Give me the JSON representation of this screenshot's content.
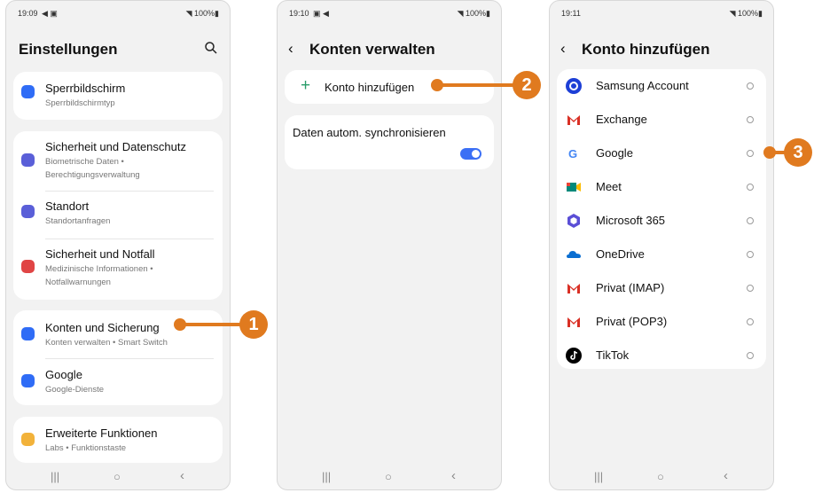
{
  "screen1": {
    "time": "19:09",
    "status_icons": "◀ ▣",
    "battery": "◥ 100%▮",
    "title": "Einstellungen",
    "items": [
      {
        "title": "Sperrbildschirm",
        "sub": "Sperrbildschirmtyp",
        "icon_color": "#2f6cf6"
      },
      {
        "title": "Sicherheit und Datenschutz",
        "sub": "Biometrische Daten •",
        "sub2": "Berechtigungsverwaltung",
        "icon_color": "#5a5fd8"
      },
      {
        "title": "Standort",
        "sub": "Standortanfragen",
        "icon_color": "#5a5fd8"
      },
      {
        "title": "Sicherheit und Notfall",
        "sub": "Medizinische Informationen •",
        "sub2": "Notfallwarnungen",
        "icon_color": "#e04545"
      },
      {
        "title": "Konten und Sicherung",
        "sub": "Konten verwalten • Smart Switch",
        "icon_color": "#2f6cf6"
      },
      {
        "title": "Google",
        "sub": "Google-Dienste",
        "icon_color": "#2f6cf6"
      },
      {
        "title": "Erweiterte Funktionen",
        "sub": "Labs • Funktionstaste",
        "icon_color": "#f2b23a"
      }
    ]
  },
  "screen2": {
    "time": "19:10",
    "status_icons": "▣ ◀",
    "battery": "◥ 100%▮",
    "title": "Konten verwalten",
    "add_label": "Konto hinzufügen",
    "sync_label": "Daten autom. synchronisieren"
  },
  "screen3": {
    "time": "19:11",
    "battery": "◥ 100%▮",
    "title": "Konto hinzufügen",
    "accounts": [
      {
        "label": "Samsung Account",
        "icon": "samsung-account-icon",
        "color": "#1d3fd6"
      },
      {
        "label": "Exchange",
        "icon": "gmail-icon",
        "color": "#d93025"
      },
      {
        "label": "Google",
        "icon": "google-icon",
        "color": "#4285f4"
      },
      {
        "label": "Meet",
        "icon": "meet-icon",
        "color": "#00897b"
      },
      {
        "label": "Microsoft 365",
        "icon": "microsoft-365-icon",
        "color": "#5b4fd6"
      },
      {
        "label": "OneDrive",
        "icon": "onedrive-icon",
        "color": "#0a6ed1"
      },
      {
        "label": "Privat (IMAP)",
        "icon": "gmail-icon",
        "color": "#d93025"
      },
      {
        "label": "Privat (POP3)",
        "icon": "gmail-icon",
        "color": "#d93025"
      },
      {
        "label": "TikTok",
        "icon": "tiktok-icon",
        "color": "#000000"
      }
    ]
  },
  "callouts": {
    "one": "1",
    "two": "2",
    "three": "3"
  },
  "nav": {
    "recent": "|||",
    "home": "○",
    "back": "‹"
  },
  "accent": "#e07a1f"
}
